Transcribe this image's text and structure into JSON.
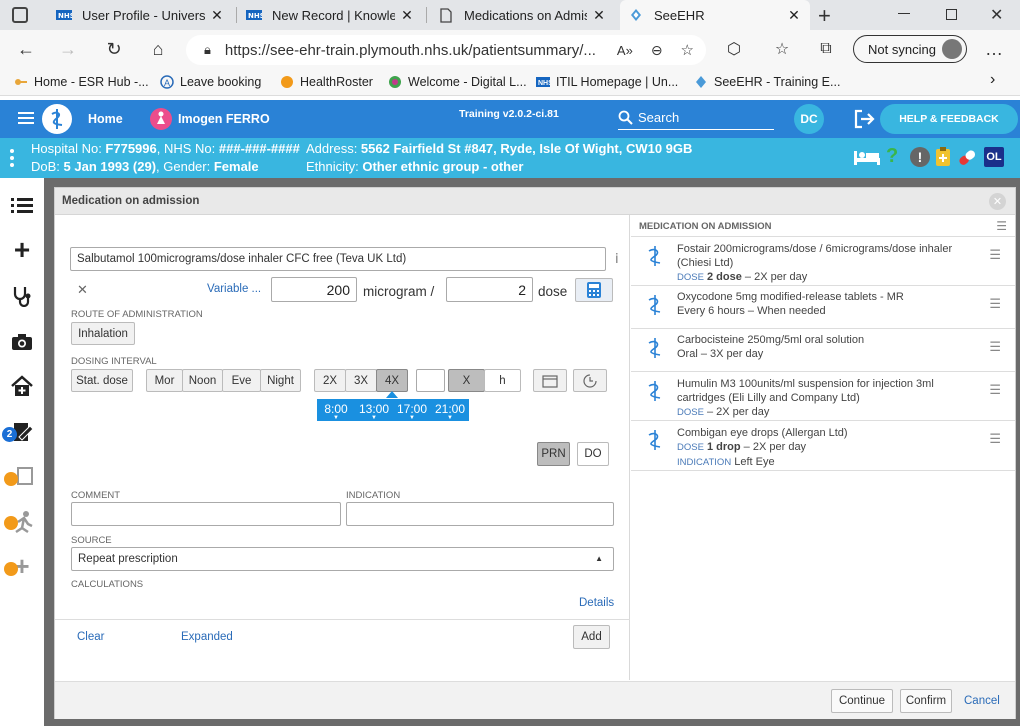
{
  "browser": {
    "tabs": [
      {
        "label": "User Profile - University"
      },
      {
        "label": "New Record | Knowledg"
      },
      {
        "label": "Medications on Admiss"
      },
      {
        "label": "SeeEHR"
      }
    ],
    "url": "https://see-ehr-train.plymouth.nhs.uk/patientsummary/...",
    "sync_label": "Not syncing",
    "bookmarks": [
      {
        "label": "Home - ESR Hub -..."
      },
      {
        "label": "Leave booking"
      },
      {
        "label": "HealthRoster"
      },
      {
        "label": "Welcome - Digital L..."
      },
      {
        "label": "ITIL Homepage | Un..."
      },
      {
        "label": "SeeEHR - Training E..."
      }
    ]
  },
  "app": {
    "home_label": "Home",
    "patient_name": "Imogen FERRO",
    "training_label": "Training v2.0.2-ci.81",
    "search_label": "Search",
    "user_initials": "DC",
    "help_label": "HELP & FEEDBACK",
    "ol_badge": "OL"
  },
  "patient": {
    "hospital_prefix": "Hospital No: ",
    "hospital_no": "F775996",
    "nhs_prefix": ", NHS No: ",
    "nhs_no": "###-###-####",
    "address_prefix": "Address: ",
    "address": "5562 Fairfield St #847, Ryde, Isle Of Wight, CW10 9GB",
    "dob_prefix": "DoB: ",
    "dob": "5 Jan 1993 (29)",
    "gender_prefix": ", Gender: ",
    "gender": "Female",
    "ethnicity_prefix": "Ethnicity: ",
    "ethnicity": "Other ethnic group - other"
  },
  "rail": {
    "badge_count": "2"
  },
  "modal": {
    "title": "Medication on admission",
    "form": {
      "drug_value": "Salbutamol 100micrograms/dose inhaler CFC free (Teva UK Ltd)",
      "variable_link": "Variable ...",
      "dose_amount": "200",
      "dose_unit": "microgram /",
      "per_amount": "2",
      "per_unit": "dose",
      "route_label": "ROUTE OF ADMINISTRATION",
      "route_button": "Inhalation",
      "interval_label": "DOSING INTERVAL",
      "stat_button": "Stat. dose",
      "time_buttons": [
        "Mor",
        "Noon",
        "Eve",
        "Night"
      ],
      "freq_buttons": [
        "2X",
        "3X",
        "4X"
      ],
      "x_button": "X",
      "h_button": "h",
      "times": [
        "8:00",
        "13:00",
        "17:00",
        "21:00"
      ],
      "prn_button": "PRN",
      "do_button": "DO",
      "comment_label": "COMMENT",
      "indication_label": "INDICATION",
      "source_label": "SOURCE",
      "source_value": "Repeat prescription",
      "calculations_label": "CALCULATIONS",
      "details_link": "Details",
      "clear_link": "Clear",
      "expanded_link": "Expanded",
      "add_button": "Add"
    },
    "list": {
      "header": "MEDICATION ON ADMISSION",
      "items": [
        {
          "name": "Fostair 200micrograms/dose / 6micrograms/dose inhaler (Chiesi Ltd)",
          "k1": "DOSE",
          "b1": "2 dose",
          "t1": " – 2X per day"
        },
        {
          "name": "Oxycodone 5mg modified-release tablets - MR",
          "l2": "Every 6 hours – When needed"
        },
        {
          "name": "Carbocisteine 250mg/5ml oral solution",
          "l2": "Oral – 3X per day"
        },
        {
          "name": "Humulin M3 100units/ml suspension for injection 3ml cartridges (Eli Lilly and Company Ltd)",
          "k1": "DOSE",
          "t1": " – 2X per day"
        },
        {
          "name": "Combigan eye drops (Allergan Ltd)",
          "k1": "DOSE",
          "b1": "1 drop",
          "t1": " – 2X per day",
          "k2": "INDICATION",
          "t2": " Left Eye"
        }
      ]
    },
    "footer": {
      "continue_button": "Continue",
      "confirm_button": "Confirm",
      "cancel_link": "Cancel"
    }
  },
  "colors": {
    "header": "#2a82d6",
    "patient_bar": "#39b6e0",
    "time_chip": "#1a90e0"
  }
}
